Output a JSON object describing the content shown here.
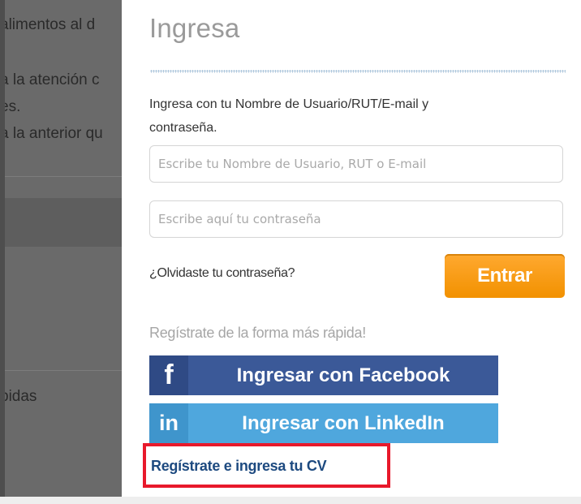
{
  "background": {
    "lines": [
      "alimentos al d",
      "a la atención c",
      "es.",
      "a la anterior qu",
      "bidas"
    ]
  },
  "login": {
    "title": "Ingresa",
    "description": "Ingresa con tu Nombre de Usuario/RUT/E-mail y contraseña.",
    "username_placeholder": "Escribe tu Nombre de Usuario, RUT o E-mail",
    "password_placeholder": "Escribe aquí tu contraseña",
    "forgot_label": "¿Olvidaste tu contraseña?",
    "enter_label": "Entrar",
    "quick_register": "Regístrate de la forma más rápida!",
    "facebook": {
      "icon": "f",
      "label": "Ingresar con Facebook"
    },
    "linkedin": {
      "icon": "in",
      "label": "Ingresar con LinkedIn"
    },
    "register_link": "Regístrate e ingresa tu CV"
  },
  "colors": {
    "enter_button": "#f29100",
    "facebook": "#3b5998",
    "linkedin": "#4fa7dd",
    "register_link": "#1d4a80",
    "highlight_box": "#e8192b"
  }
}
